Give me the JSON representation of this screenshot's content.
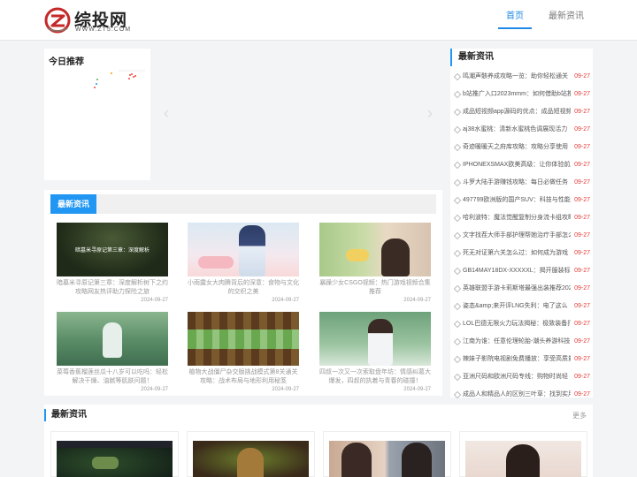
{
  "header": {
    "logo_name": "综投网",
    "logo_domain": "WWW.ZT5.COM",
    "nav": [
      {
        "label": "首页"
      },
      {
        "label": "最新资讯"
      }
    ]
  },
  "today": {
    "title": "今日推荐"
  },
  "news_block": {
    "tab": "最新资讯",
    "cards": [
      {
        "title": "暗墓米寻原记第三章：深度解析树下之约攻略网友热评助力探险之旅",
        "date": "2024-09-27"
      },
      {
        "title": "小雨露女大肉腾背后的深意：食物与文化的交织之美",
        "date": "2024-09-27"
      },
      {
        "title": "暴躁少女CSGO视频：热门游戏视频合集推荐",
        "date": "2024-09-27"
      },
      {
        "title": "菜莓香蕉榴莲丝瓜十八岁可以吃吗：轻松解决干燥、油腻等肌肤问题！",
        "date": "2024-09-27"
      },
      {
        "title": "植物大战僵尸杂交版挑战模式第8关通关攻略：战术布局与地形利用秘笈",
        "date": "2024-09-27"
      },
      {
        "title": "四叔一次又一次索取盘年坊：情感纠葛大爆发，四叔的执着与青春的碰撞！",
        "date": "2024-09-27"
      }
    ]
  },
  "sidebar": {
    "title": "最新资讯",
    "items": [
      {
        "text": "鸣潮声骸养成攻略一览：助你轻松通关",
        "date": "09-27"
      },
      {
        "text": "b站推广入口2023mmm：如何借助b站推广",
        "date": "09-27"
      },
      {
        "text": "成品短视频app源码的优点：成品短视频",
        "date": "09-27"
      },
      {
        "text": "aj38水蜜桃：清新水蜜桃色调展现活力",
        "date": "09-27"
      },
      {
        "text": "奇迹暖暖天之府库攻略：攻略分享使用",
        "date": "09-27"
      },
      {
        "text": "IPHONEXSMAX欧美高级：让你体验前所未",
        "date": "09-27"
      },
      {
        "text": "斗罗大陆手游赚钱攻略：每日必做任务",
        "date": "09-27"
      },
      {
        "text": "497799欧洲版的国产SUV：科技与性能",
        "date": "09-27"
      },
      {
        "text": "哈利波特：魔法觉醒复制分身流卡组攻略",
        "date": "09-27"
      },
      {
        "text": "文字找茬大师手部护理帮她治疗手部怎么",
        "date": "09-27"
      },
      {
        "text": "死无对证第六关怎么过：如何成为游戏",
        "date": "09-27"
      },
      {
        "text": "GB14MAY18DX-XXXXXL：揭开服装标准",
        "date": "09-27"
      },
      {
        "text": "英雄联盟手游卡莉斯塔最强出装推荐2024",
        "date": "09-27"
      },
      {
        "text": "姿态&amp;来开评LNG失利：电了这么",
        "date": "09-27"
      },
      {
        "text": "LOL巴德无限火力玩法揭秘：极致装备打",
        "date": "09-27"
      },
      {
        "text": "江南为谁：任意伦理轮胎-潮头养游科技",
        "date": "09-27"
      },
      {
        "text": "辣妹子影院电视剧免费播放：享受高质量",
        "date": "09-27"
      },
      {
        "text": "亚洲尺码和欧洲尺码专线：购物时尚轻",
        "date": "09-27"
      },
      {
        "text": "成品人和精品人的区别三叶草：找到实用",
        "date": "09-27"
      }
    ]
  },
  "news2": {
    "title": "最新资讯",
    "more": "更多"
  },
  "colors": {
    "accent": "#2196f3",
    "date_red": "#e53935",
    "logo_red": "#c62828"
  }
}
